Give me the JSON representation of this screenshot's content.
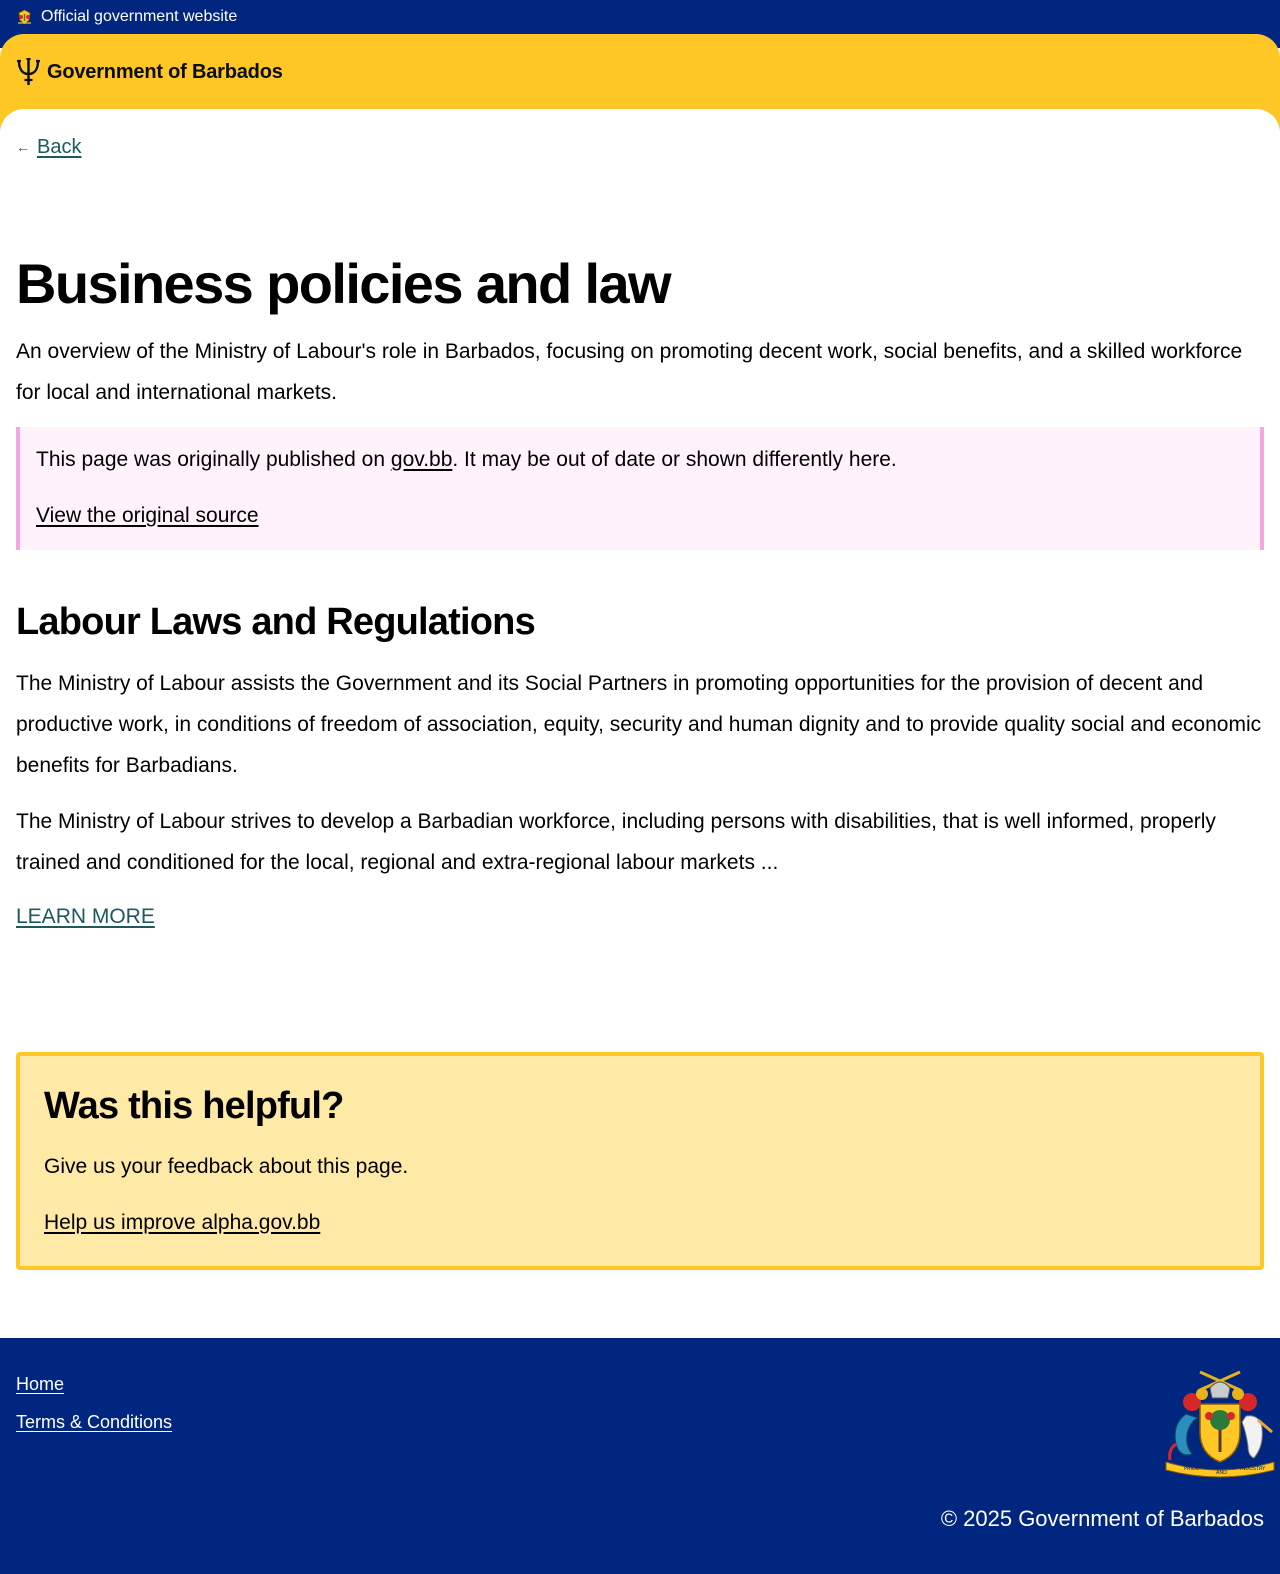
{
  "official_banner": {
    "text": "Official government website",
    "icon": "barbados-crest-icon"
  },
  "header": {
    "brand_icon": "trident-icon",
    "brand": "Government of Barbados"
  },
  "nav": {
    "back_icon": "arrow-left-icon",
    "back_label": "Back"
  },
  "main": {
    "title": "Business policies and law",
    "lead": "An overview of the Ministry of Labour's role in Barbados, focusing on promoting decent work, social benefits, and a skilled workforce for local and international markets."
  },
  "notice": {
    "text_before": "This page was originally published on ",
    "link": "gov.bb",
    "text_after": ". It may be out of date or shown differently here.",
    "source_link": "View the original source"
  },
  "section": {
    "heading": "Labour Laws and Regulations",
    "paragraphs": [
      "The Ministry of Labour assists the Government and its Social Partners in promoting opportunities for the provision of decent and productive work, in conditions of freedom of association, equity, security and human dignity and to provide quality social and economic benefits for Barbadians.",
      "The Ministry of Labour strives to develop a Barbadian workforce, including persons with disabilities, that is well informed, properly trained and conditioned for the local, regional and extra-regional labour markets ..."
    ],
    "learn_more": "LEARN MORE"
  },
  "feedback": {
    "heading": "Was this helpful?",
    "text": "Give us your feedback about this page.",
    "link": "Help us improve alpha.gov.bb"
  },
  "footer": {
    "links": [
      "Home",
      "Terms & Conditions"
    ],
    "crest": "barbados-coat-of-arms",
    "crest_motto": [
      "PRIDE",
      "AND",
      "INDUSTRY"
    ],
    "copyright": "© 2025 Government of Barbados"
  },
  "colors": {
    "banner_blue": "#00267f",
    "header_yellow": "#ffc726",
    "link_teal": "#1e5a5c",
    "notice_bg": "#fff2fa",
    "notice_border": "#f6a6e0",
    "feedback_bg": "#ffe9a6"
  }
}
